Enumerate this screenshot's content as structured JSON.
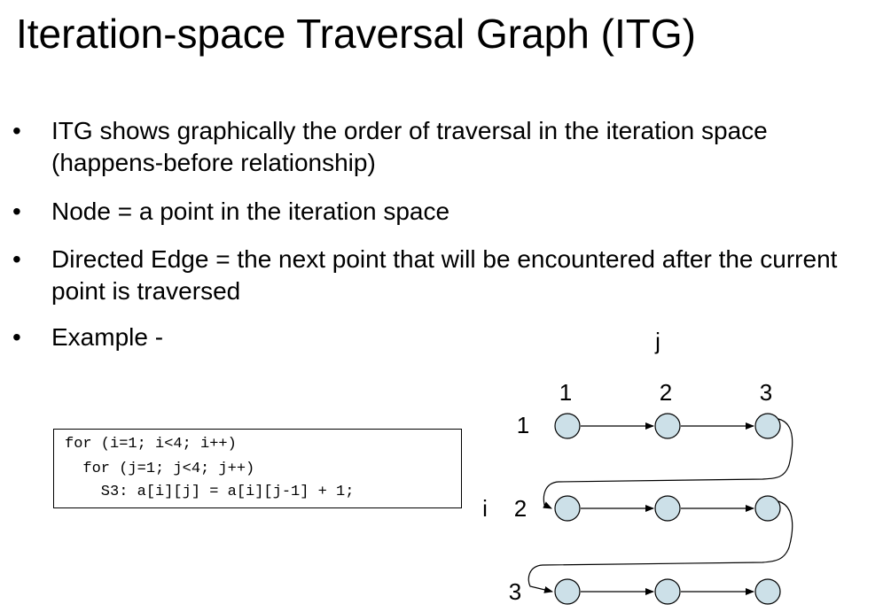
{
  "slide": {
    "title": "Iteration-space Traversal Graph (ITG)",
    "bullet_marker": "•",
    "bullets": [
      "ITG shows graphically the order of traversal in the iteration space (happens-before relationship)",
      "Node = a point in the iteration space",
      "Directed Edge = the next point that will be encountered after the current point is traversed",
      "Example -"
    ]
  },
  "code": {
    "lines": [
      "for (i=1; i<4; i++)",
      "  for (j=1; j<4; j++)",
      "    S3: a[i][j] = a[i][j-1] + 1;"
    ]
  },
  "graph": {
    "axis_j_label": "j",
    "axis_i_label": "i",
    "j_values": [
      "1",
      "2",
      "3"
    ],
    "i_values": [
      "1",
      "2",
      "3"
    ],
    "node_fill": "#cce0e8",
    "node_stroke": "#000000"
  }
}
